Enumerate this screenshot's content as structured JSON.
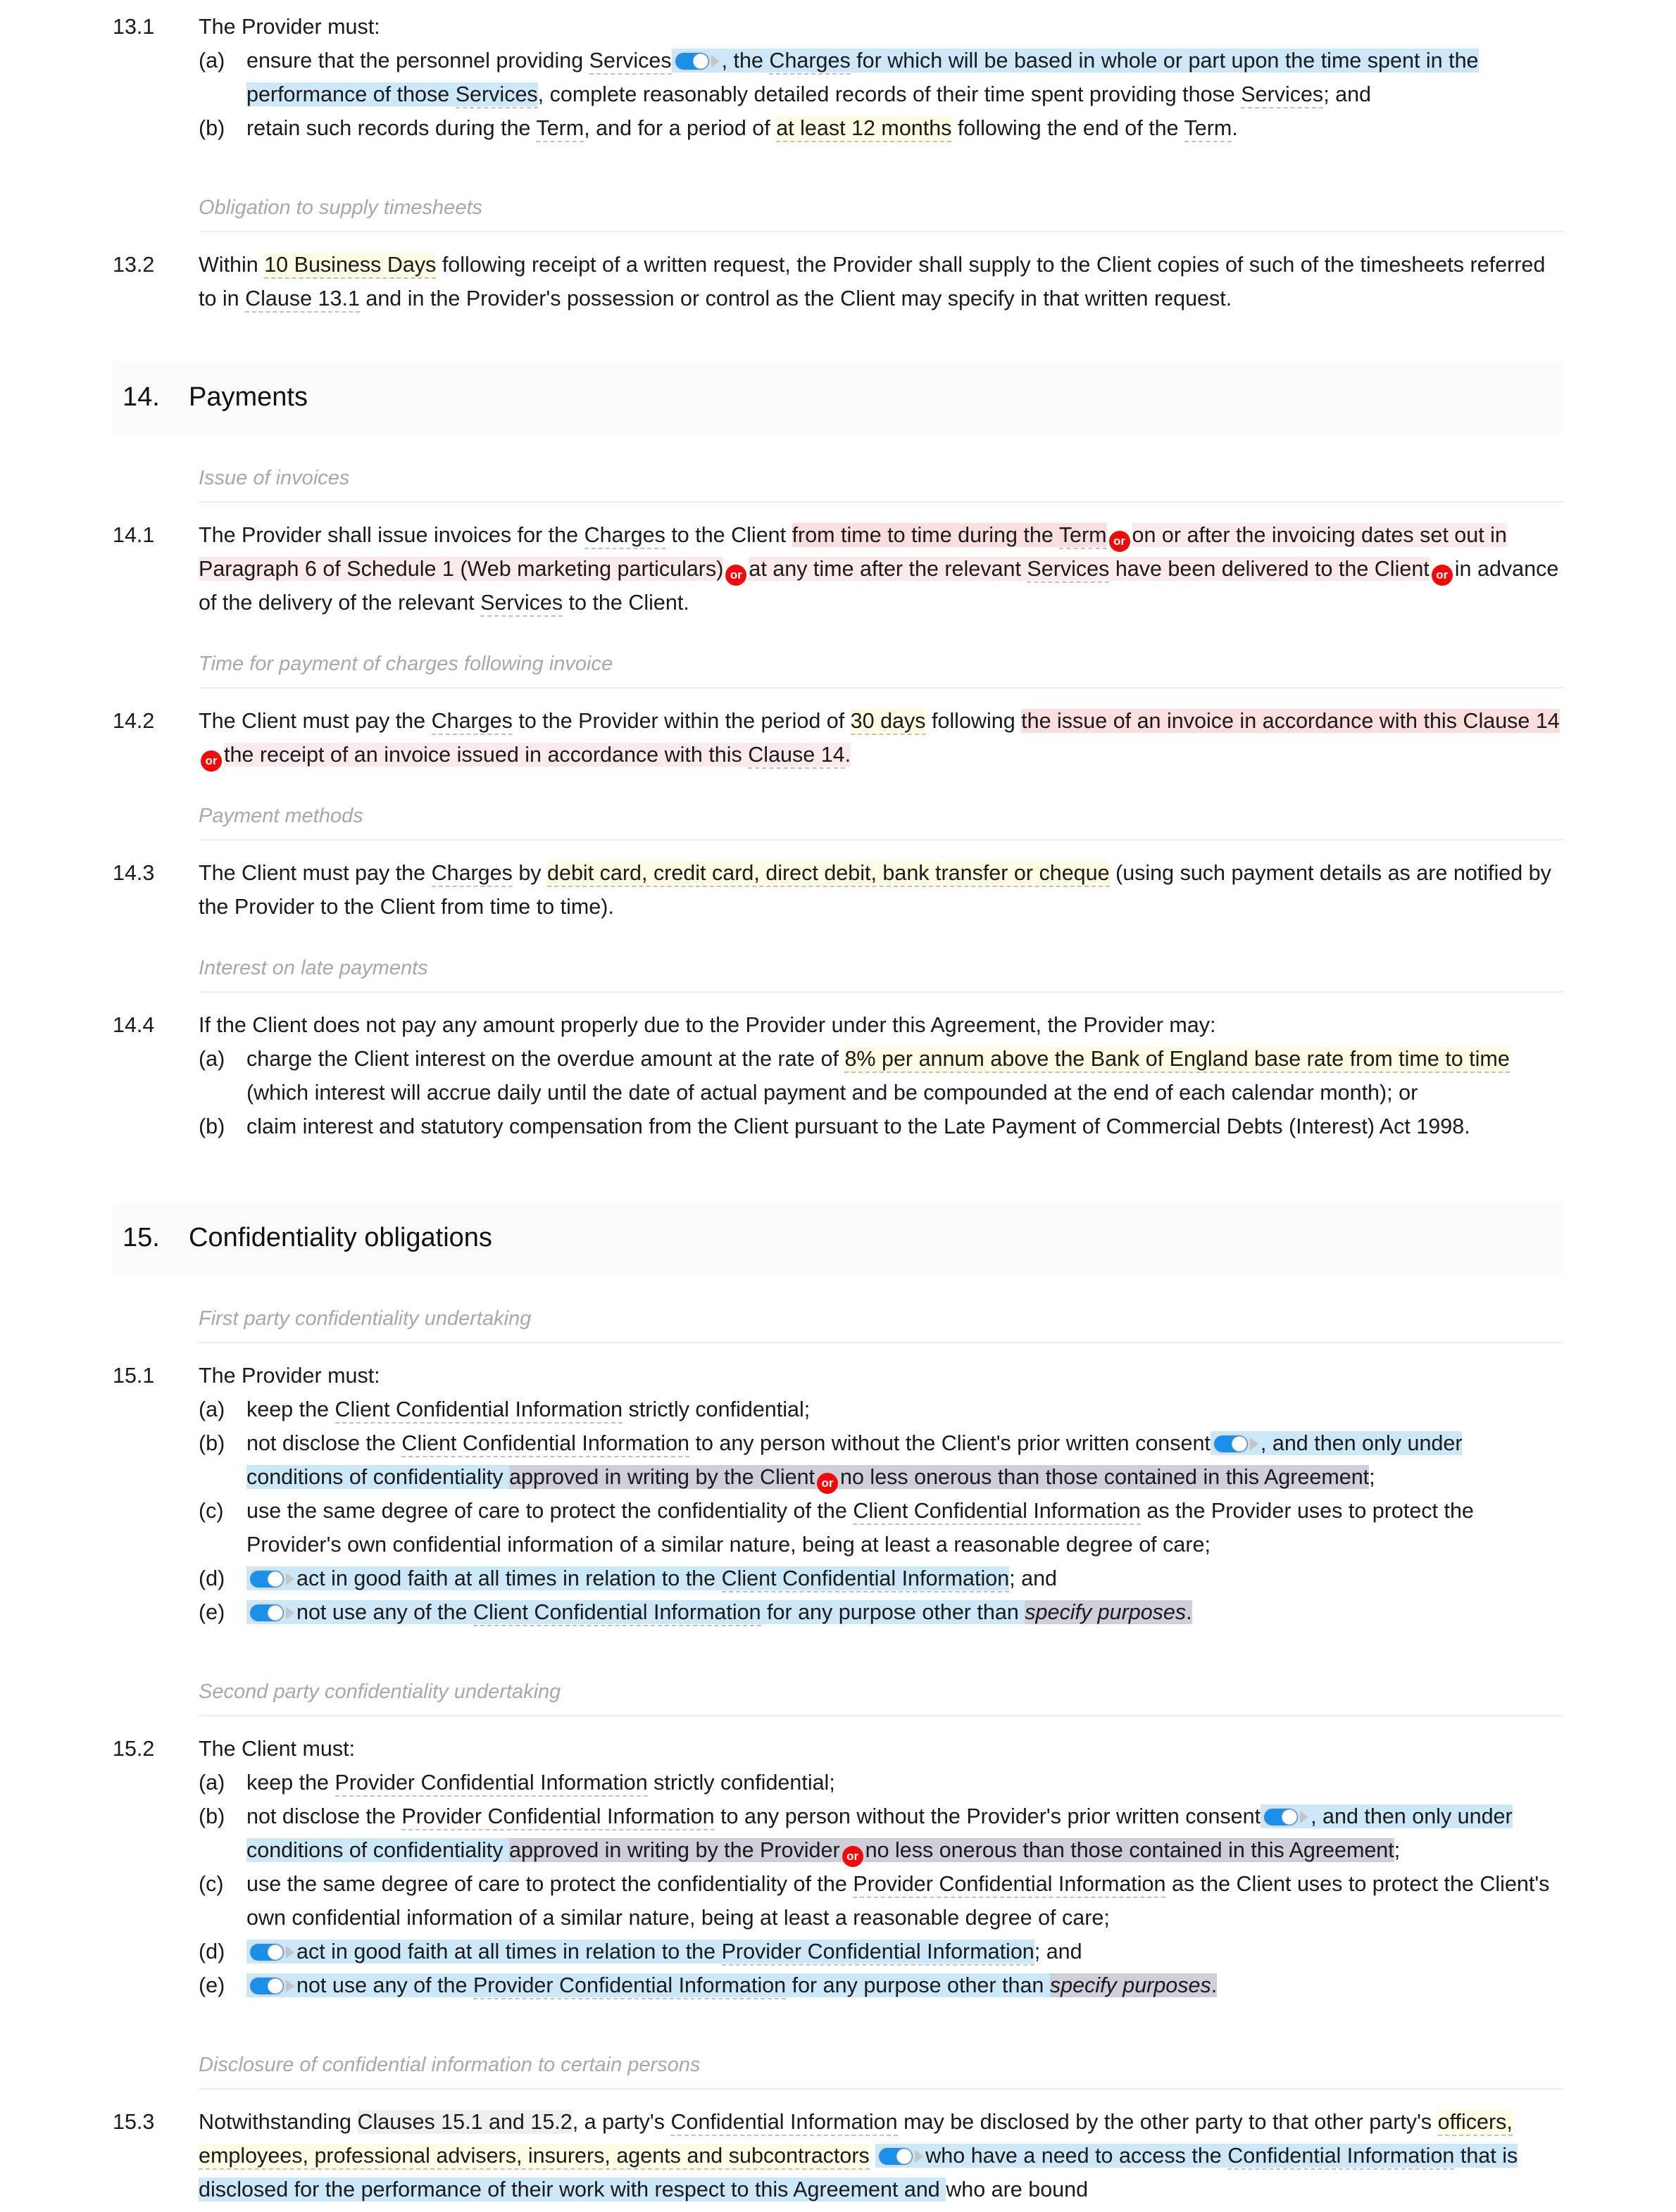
{
  "document": {
    "type": "legal-agreement-clauses",
    "icons": {
      "toggle": "toggle-switch-on-icon",
      "or": "or-alternative-badge-icon"
    }
  },
  "clause_13_1": {
    "number": "13.1",
    "lead": "The Provider must:",
    "a_letter": "(a)",
    "a_t1": "ensure that the personnel providing ",
    "a_services1": "Services",
    "a_t2": ", the ",
    "a_charges": "Charges",
    "a_t3": " for which will be based in whole or part upon the time spent in the performance of those ",
    "a_services2": "Services",
    "a_t4": ", complete reasonably detailed records of their time spent providing those ",
    "a_services3": "Services",
    "a_t5": "; and",
    "b_letter": "(b)",
    "b_t1": "retain such records during the ",
    "b_term1": "Term",
    "b_t2": ", and for a period of ",
    "b_period": "at least 12 months",
    "b_t3": " following the end of the ",
    "b_term2": "Term",
    "b_t4": "."
  },
  "subhead_timesheets": "Obligation to supply timesheets",
  "clause_13_2": {
    "number": "13.2",
    "t1": "Within ",
    "days": "10 Business Days",
    "t2": " following receipt of a written request, the Provider shall supply to the Client copies of such of the timesheets referred to in ",
    "clause_ref": "Clause 13.1",
    "t3": " and in the Provider's possession or control as the Client may specify in that written request."
  },
  "section_14": {
    "number": "14.",
    "title": "Payments"
  },
  "subhead_invoices": "Issue of invoices",
  "clause_14_1": {
    "number": "14.1",
    "t1": "The Provider shall issue invoices for the ",
    "charges": "Charges",
    "t2": " to the Client ",
    "h1": "from time to time during the ",
    "term": "Term",
    "or1": "or",
    "h2": "on or after the invoicing dates set out in Paragraph 6 of Schedule 1 (Web marketing particulars)",
    "or2": "or",
    "h3": "at any time after the relevant ",
    "services1": "Services",
    "h3b": " have been delivered to the Client",
    "or3": "or",
    "h4": "in advance of the delivery of the relevant ",
    "services2": "Services",
    "h4b": " to the Client."
  },
  "subhead_time_payment": "Time for payment of charges following invoice",
  "clause_14_2": {
    "number": "14.2",
    "t1": "The Client must pay the ",
    "charges": "Charges",
    "t2": " to the Provider within the period of ",
    "days": "30 days",
    "t3": " following ",
    "h1": "the issue of an invoice in accordance with this Clause 14",
    "or": "or",
    "h2": "the receipt of an invoice issued in accordance with this ",
    "clause_ref": "Clause 14",
    "h2b": "."
  },
  "subhead_payment_methods": "Payment methods",
  "clause_14_3": {
    "number": "14.3",
    "t1": "The Client must pay the ",
    "charges": "Charges",
    "t2": " by ",
    "methods": "debit card, credit card, direct debit, bank transfer or cheque",
    "t3": " (using such payment details as are notified by the Provider to the Client from time to time)."
  },
  "subhead_interest": "Interest on late payments",
  "clause_14_4": {
    "number": "14.4",
    "lead": "If the Client does not pay any amount properly due to the Provider under this Agreement, the Provider may:",
    "a_letter": "(a)",
    "a_t1": "charge the Client interest on the overdue amount at the rate of ",
    "a_rate": "8% per annum above the Bank of England base rate from time to time",
    "a_t2": " (which interest will accrue daily until the date of actual payment and be compounded at the end of each calendar month); or",
    "b_letter": "(b)",
    "b_t1": "claim interest and statutory compensation from the Client pursuant to the Late Payment of Commercial Debts (Interest) Act 1998."
  },
  "section_15": {
    "number": "15.",
    "title": "Confidentiality obligations"
  },
  "subhead_first_party": "First party confidentiality undertaking",
  "clause_15_1": {
    "number": "15.1",
    "lead": "The Provider must:",
    "a_letter": "(a)",
    "a_t1": "keep the ",
    "a_cci": "Client Confidential Information",
    "a_t2": " strictly confidential;",
    "b_letter": "(b)",
    "b_t1": "not disclose the ",
    "b_cci": "Client Confidential Information",
    "b_t2": " to any person without the Client's prior written consent",
    "b_h1": ", and then only under conditions of confidentiality ",
    "b_h2": "approved in writing by the Client",
    "b_or": "or",
    "b_h3": "no less onerous than those contained in this Agreement",
    "b_t3": ";",
    "c_letter": "(c)",
    "c_t1": "use the same degree of care to protect the confidentiality of the ",
    "c_cci": "Client Confidential Information",
    "c_t2": " as the Provider uses to protect the Provider's own confidential information of a similar nature, being at least a reasonable degree of care;",
    "d_letter": "(d)",
    "d_t1": "act in good faith at all times in relation to the ",
    "d_cci": "Client Confidential Information",
    "d_t2": "; and",
    "e_letter": "(e)",
    "e_t1": "not use any of the ",
    "e_cci": "Client Confidential Information",
    "e_t2": " for any purpose other than ",
    "e_specify": "specify purposes",
    "e_t3": "."
  },
  "subhead_second_party": "Second party confidentiality undertaking",
  "clause_15_2": {
    "number": "15.2",
    "lead": "The Client must:",
    "a_letter": "(a)",
    "a_t1": "keep the ",
    "a_pci": "Provider Confidential Information",
    "a_t2": " strictly confidential;",
    "b_letter": "(b)",
    "b_t1": "not disclose the ",
    "b_pci": "Provider Confidential Information",
    "b_t2": " to any person without the Provider's prior written consent",
    "b_h1": ", and then only under conditions of confidentiality ",
    "b_h2": "approved in writing by the Provider",
    "b_or": "or",
    "b_h3": "no less onerous than those contained in this Agreement",
    "b_t3": ";",
    "c_letter": "(c)",
    "c_t1": "use the same degree of care to protect the confidentiality of the ",
    "c_pci": "Provider Confidential Information",
    "c_t2": " as the Client uses to protect the Client's own confidential information of a similar nature, being at least a reasonable degree of care;",
    "d_letter": "(d)",
    "d_t1": "act in good faith at all times in relation to the ",
    "d_pci": "Provider Confidential Information",
    "d_t2": "; and",
    "e_letter": "(e)",
    "e_t1": "not use any of the ",
    "e_pci": "Provider Confidential Information",
    "e_t2": " for any purpose other than ",
    "e_specify": "specify purposes",
    "e_t3": "."
  },
  "subhead_disclosure": "Disclosure of confidential information to certain persons",
  "clause_15_3": {
    "number": "15.3",
    "t1": "Notwithstanding ",
    "clauses_ref": "Clauses 15.1 and 15.2",
    "t2": ", a party's ",
    "ci": "Confidential Information",
    "t3": " may be disclosed by the other party to that other party's ",
    "persons": "officers, employees, professional advisers, insurers, agents and subcontractors",
    "t4": " ",
    "h1": "who have a need to access the ",
    "ci2": "Confidential Information",
    "h1b": " that is disclosed for the performance of their work with respect to this Agreement and ",
    "t5": "who are bound"
  }
}
